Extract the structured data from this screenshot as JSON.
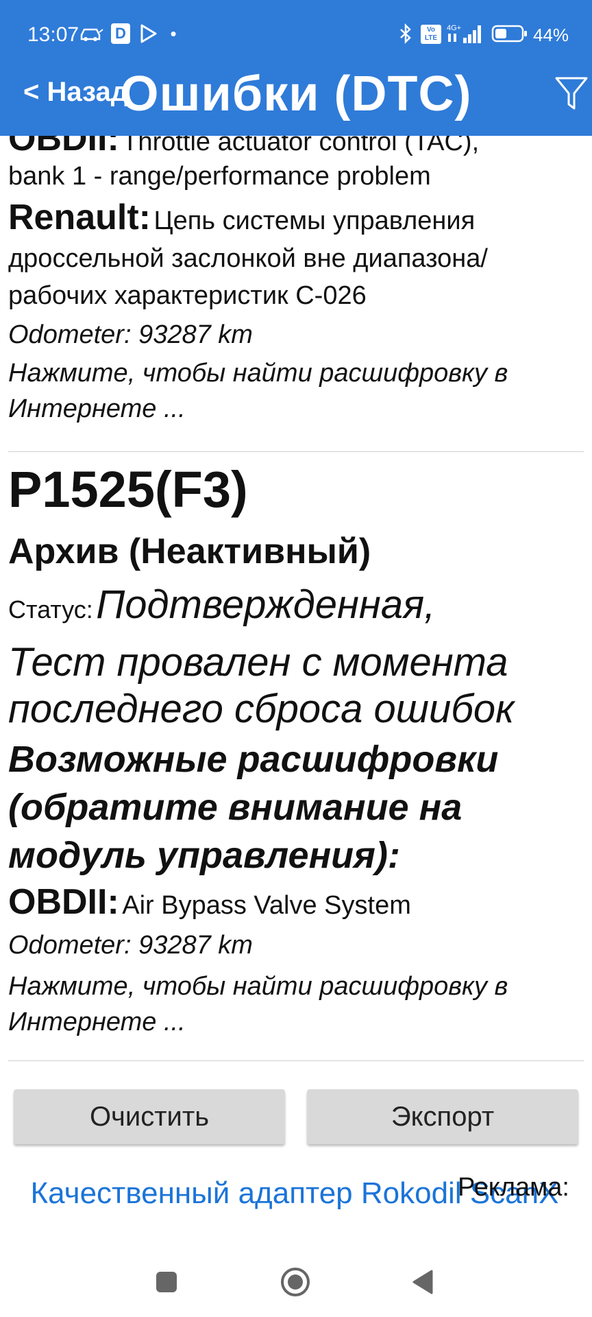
{
  "status_bar": {
    "time": "13:07",
    "d_badge": "D",
    "volte": "Vo LTE",
    "network": "4G+",
    "battery_pct": "44%",
    "battery_level": 0.44
  },
  "header": {
    "back_label": "< Назад",
    "title": "Ошибки (DTC)"
  },
  "entry_top": {
    "obd_label": "OBDII:",
    "obd_desc_line1": "Throttle actuator control (TAC),",
    "obd_desc_line2": "bank 1 - range/performance problem",
    "maker_label": "Renault:",
    "maker_desc_line1": "Цепь системы управления",
    "maker_desc_line2": "дроссельной заслонкой вне диапазона/",
    "maker_desc_line3": "рабочих характеристик C-026",
    "odometer": "Odometer: 93287 km",
    "search_line1": "Нажмите, чтобы найти расшифровку в",
    "search_line2": "Интернете ..."
  },
  "entry_main": {
    "code": "P1525(F3)",
    "archive": "Архив (Неактивный)",
    "status_label": "Статус:",
    "status_line1": "Подтвержденная,",
    "status_line2": "Тест провален с момента",
    "status_line3": "последнего сброса ошибок",
    "possible_line1": "Возможные расшифровки",
    "possible_line2": "(обратите внимание на",
    "possible_line3": "модуль управления):",
    "obd_label": "OBDII:",
    "obd_desc": "Air Bypass Valve System",
    "odometer": "Odometer: 93287 km",
    "search_line1": "Нажмите, чтобы найти расшифровку в",
    "search_line2": "Интернете ..."
  },
  "buttons": {
    "clear": "Очистить",
    "export": "Экспорт"
  },
  "ad": {
    "link_text": "Качественный адаптер Rokodil ScanX",
    "label": "Реклама:"
  },
  "nav": {
    "recent": "square-icon",
    "home": "circle-icon",
    "back": "triangle-back-icon"
  },
  "colors": {
    "appbar": "#2f7bd8",
    "link": "#1b74d8",
    "button": "#d9d9d9"
  }
}
